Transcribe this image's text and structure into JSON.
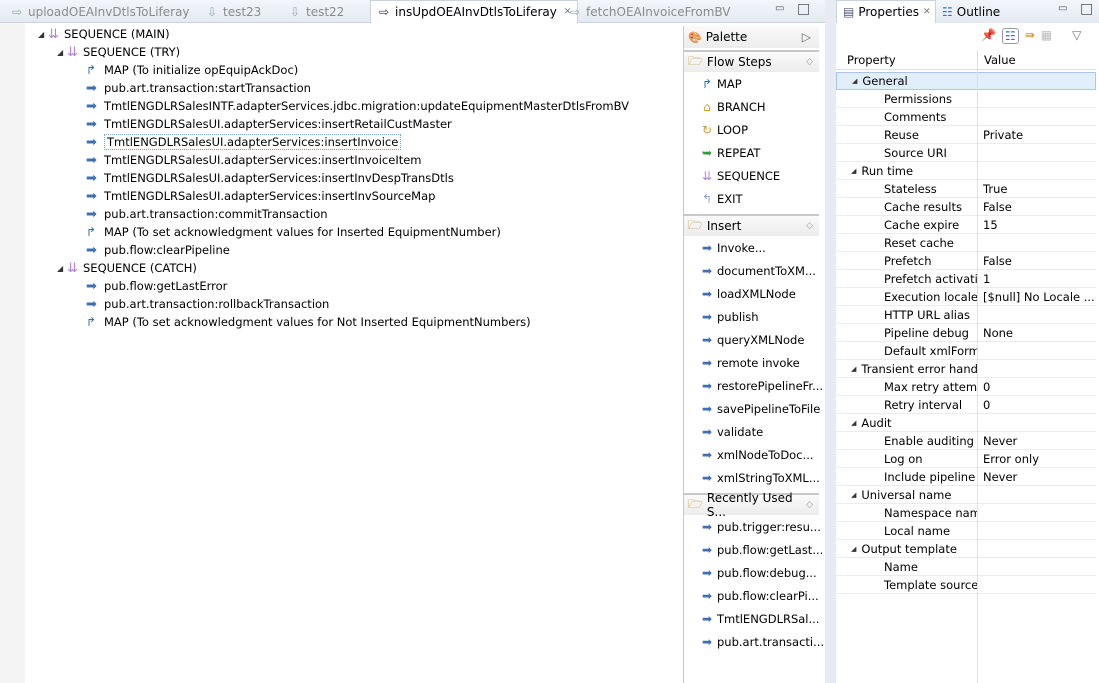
{
  "editor": {
    "tabs": [
      {
        "label": "uploadOEAInvDtlsToLiferay",
        "active": false
      },
      {
        "label": "test23",
        "active": false
      },
      {
        "label": "test22",
        "active": false
      },
      {
        "label": "insUpdOEAInvDtlsToLiferay",
        "active": true
      },
      {
        "label": "fetchOEAInvoiceFromBV",
        "active": false
      }
    ],
    "tree": [
      {
        "label": "SEQUENCE (MAIN)",
        "level": 0,
        "type": "sequence",
        "expanded": true
      },
      {
        "label": "SEQUENCE (TRY)",
        "level": 1,
        "type": "sequence",
        "expanded": true
      },
      {
        "label": "MAP (To initialize opEquipAckDoc)",
        "level": 2,
        "type": "map"
      },
      {
        "label": "pub.art.transaction:startTransaction",
        "level": 2,
        "type": "invoke"
      },
      {
        "label": "TmtlENGDLRSalesINTF.adapterServices.jdbc.migration:updateEquipmentMasterDtlsFromBV",
        "level": 2,
        "type": "invoke"
      },
      {
        "label": "TmtlENGDLRSalesUI.adapterServices:insertRetailCustMaster",
        "level": 2,
        "type": "invoke"
      },
      {
        "label": "TmtlENGDLRSalesUI.adapterServices:insertInvoice",
        "level": 2,
        "type": "invoke",
        "selected": true
      },
      {
        "label": "TmtlENGDLRSalesUI.adapterServices:insertInvoiceItem",
        "level": 2,
        "type": "invoke"
      },
      {
        "label": "TmtlENGDLRSalesUI.adapterServices:insertInvDespTransDtls",
        "level": 2,
        "type": "invoke"
      },
      {
        "label": "TmtlENGDLRSalesUI.adapterServices:insertInvSourceMap",
        "level": 2,
        "type": "invoke"
      },
      {
        "label": "pub.art.transaction:commitTransaction",
        "level": 2,
        "type": "invoke"
      },
      {
        "label": "MAP (To set acknowledgment values for Inserted EquipmentNumber)",
        "level": 2,
        "type": "map"
      },
      {
        "label": "pub.flow:clearPipeline",
        "level": 2,
        "type": "invoke"
      },
      {
        "label": "SEQUENCE (CATCH)",
        "level": 1,
        "type": "sequence",
        "expanded": true
      },
      {
        "label": "pub.flow:getLastError",
        "level": 2,
        "type": "invoke"
      },
      {
        "label": "pub.art.transaction:rollbackTransaction",
        "level": 2,
        "type": "invoke"
      },
      {
        "label": "MAP (To set acknowledgment values for Not Inserted EquipmentNumbers)",
        "level": 2,
        "type": "map"
      }
    ]
  },
  "palette": {
    "title": "Palette",
    "sections": [
      {
        "title": "Flow Steps",
        "items": [
          {
            "label": "MAP",
            "icon": "map"
          },
          {
            "label": "BRANCH",
            "icon": "branch"
          },
          {
            "label": "LOOP",
            "icon": "loop"
          },
          {
            "label": "REPEAT",
            "icon": "repeat"
          },
          {
            "label": "SEQUENCE",
            "icon": "sequence"
          },
          {
            "label": "EXIT",
            "icon": "exit"
          }
        ]
      },
      {
        "title": "Insert",
        "items": [
          {
            "label": "Invoke...",
            "icon": "invoke"
          },
          {
            "label": "documentToXM...",
            "icon": "invoke"
          },
          {
            "label": "loadXMLNode",
            "icon": "invoke"
          },
          {
            "label": "publish",
            "icon": "invoke"
          },
          {
            "label": "queryXMLNode",
            "icon": "invoke"
          },
          {
            "label": "remote invoke",
            "icon": "invoke"
          },
          {
            "label": "restorePipelineFr...",
            "icon": "invoke"
          },
          {
            "label": "savePipelineToFile",
            "icon": "invoke"
          },
          {
            "label": "validate",
            "icon": "invoke"
          },
          {
            "label": "xmlNodeToDoc...",
            "icon": "invoke"
          },
          {
            "label": "xmlStringToXML...",
            "icon": "invoke"
          }
        ]
      },
      {
        "title": "Recently Used S...",
        "items": [
          {
            "label": "pub.trigger:resu...",
            "icon": "invoke"
          },
          {
            "label": "pub.flow:getLast...",
            "icon": "invoke"
          },
          {
            "label": "pub.flow:debug...",
            "icon": "invoke"
          },
          {
            "label": "pub.flow:clearPi...",
            "icon": "invoke"
          },
          {
            "label": "TmtlENGDLRSal...",
            "icon": "invoke"
          },
          {
            "label": "pub.art.transacti...",
            "icon": "invoke"
          }
        ]
      }
    ]
  },
  "properties": {
    "tabs": [
      {
        "label": "Properties",
        "active": true
      },
      {
        "label": "Outline",
        "active": false
      }
    ],
    "columns": [
      "Property",
      "Value"
    ],
    "rows": [
      {
        "key": "General",
        "group": true
      },
      {
        "key": "Permissions",
        "value": ""
      },
      {
        "key": "Comments",
        "value": ""
      },
      {
        "key": "Reuse",
        "value": "Private"
      },
      {
        "key": "Source URI",
        "value": ""
      },
      {
        "key": "Run time",
        "group": true
      },
      {
        "key": "Stateless",
        "value": "True"
      },
      {
        "key": "Cache results",
        "value": "False"
      },
      {
        "key": "Cache expire",
        "value": "15"
      },
      {
        "key": "Reset cache",
        "value": ""
      },
      {
        "key": "Prefetch",
        "value": "False"
      },
      {
        "key": "Prefetch activatio",
        "value": "1"
      },
      {
        "key": "Execution locale",
        "value": "[$null] No Locale ..."
      },
      {
        "key": "HTTP URL alias",
        "value": ""
      },
      {
        "key": "Pipeline debug",
        "value": "None"
      },
      {
        "key": "Default xmlForma",
        "value": ""
      },
      {
        "key": "Transient error handli",
        "group": true
      },
      {
        "key": "Max retry attempt",
        "value": "0"
      },
      {
        "key": "Retry interval",
        "value": "0"
      },
      {
        "key": "Audit",
        "group": true
      },
      {
        "key": "Enable auditing",
        "value": "Never"
      },
      {
        "key": "Log on",
        "value": "Error only"
      },
      {
        "key": "Include pipeline",
        "value": "Never"
      },
      {
        "key": "Universal name",
        "group": true
      },
      {
        "key": "Namespace name",
        "value": ""
      },
      {
        "key": "Local name",
        "value": ""
      },
      {
        "key": "Output template",
        "group": true
      },
      {
        "key": "Name",
        "value": ""
      },
      {
        "key": "Template source",
        "value": ""
      }
    ]
  }
}
